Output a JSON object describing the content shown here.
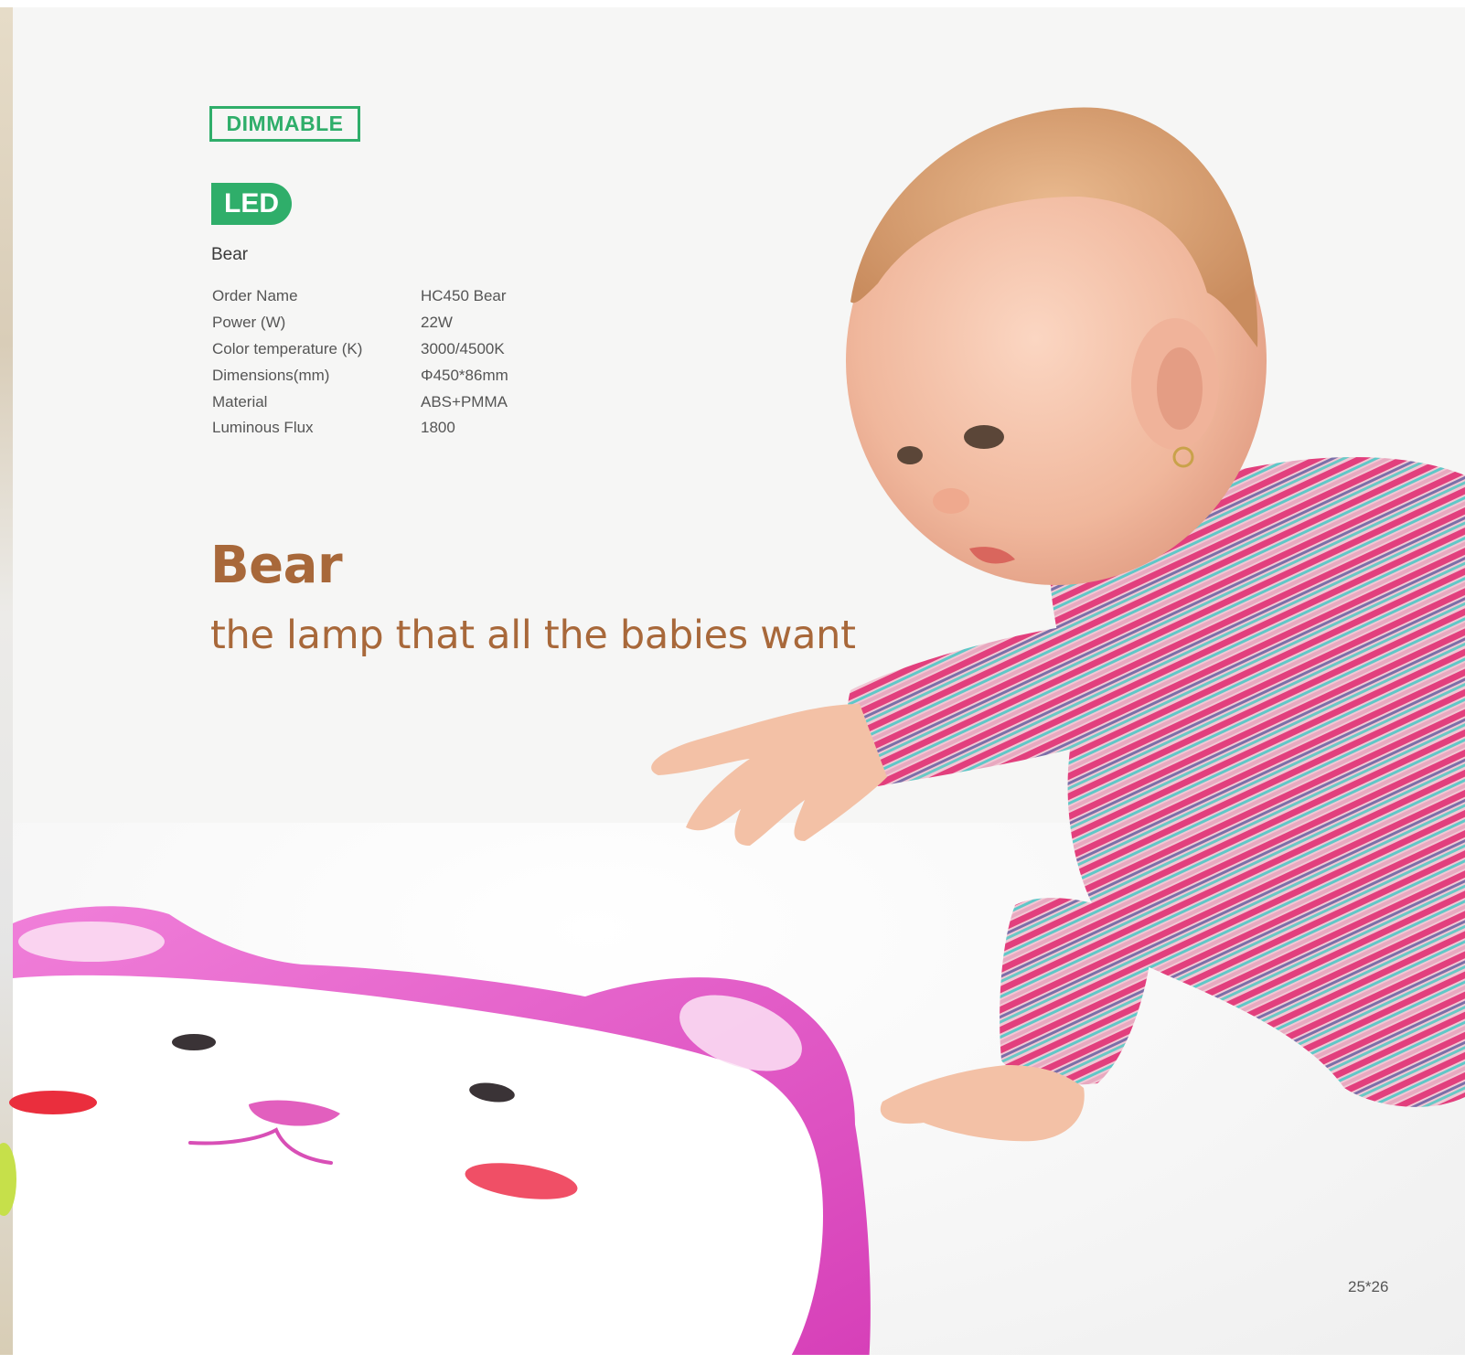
{
  "badges": {
    "dimmable": "DIMMABLE",
    "led": "LED"
  },
  "product": {
    "label": "Bear"
  },
  "specs": [
    {
      "key": "Order Name",
      "value": "HC450 Bear"
    },
    {
      "key": "Power (W)",
      "value": "22W"
    },
    {
      "key": "Color temperature (K)",
      "value": "3000/4500K"
    },
    {
      "key": "Dimensions(mm)",
      "value": "Φ450*86mm"
    },
    {
      "key": "Material",
      "value": "ABS+PMMA"
    },
    {
      "key": "Luminous Flux",
      "value": "1800"
    }
  ],
  "headline": "Bear",
  "tagline": "the lamp that all the babies want",
  "page_number": "25*26",
  "colors": {
    "accent_green": "#2fae6a",
    "headline_brown": "#a8683a",
    "lamp_pink": "#e44fc7"
  }
}
